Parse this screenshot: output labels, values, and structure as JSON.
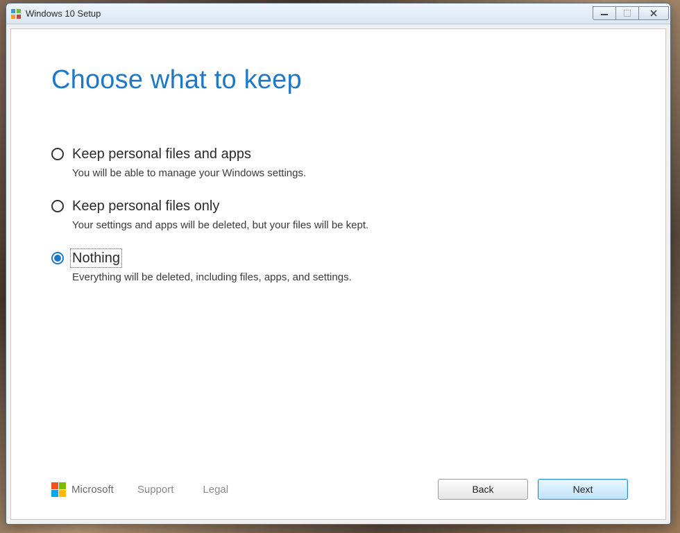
{
  "window": {
    "title": "Windows 10 Setup"
  },
  "page": {
    "title": "Choose what to keep"
  },
  "options": [
    {
      "label": "Keep personal files and apps",
      "desc": "You will be able to manage your Windows settings.",
      "selected": false
    },
    {
      "label": "Keep personal files only",
      "desc": "Your settings and apps will be deleted, but your files will be kept.",
      "selected": false
    },
    {
      "label": "Nothing",
      "desc": "Everything will be deleted, including files, apps, and settings.",
      "selected": true
    }
  ],
  "footer": {
    "brand": "Microsoft",
    "support": "Support",
    "legal": "Legal",
    "back": "Back",
    "next": "Next"
  }
}
